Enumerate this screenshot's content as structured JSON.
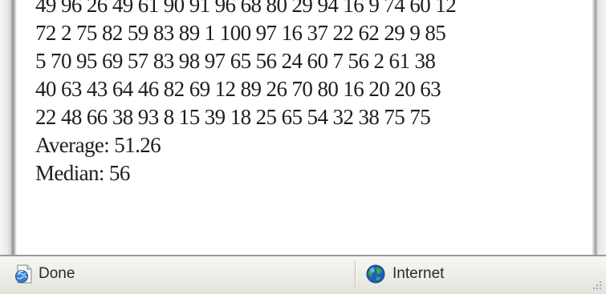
{
  "content": {
    "number_lines": [
      "49 96 26 49 61 90 91 96 68 80 29 94 16 9 74 60 12",
      "72 2 75 82 59 83 89 1 100 97 16 37 22 62 29 9 85",
      "5 70 95 69 57 83 98 97 65 56 24 60 7 56 2 61 38",
      "40 63 43 64 46 82 69 12 89 26 70 80 16 20 20 63",
      "22 48 66 38 93 8 15 39 18 25 65 54 32 38 75 75"
    ],
    "average_line": "Average: 51.26",
    "median_line": "Median: 56"
  },
  "statusbar": {
    "status_text": "Done",
    "zone_text": "Internet",
    "status_icon": "page-done-icon",
    "zone_icon": "globe-icon"
  },
  "colors": {
    "text": "#1e1e1e",
    "statusbar_bg": "#ecebe6"
  }
}
